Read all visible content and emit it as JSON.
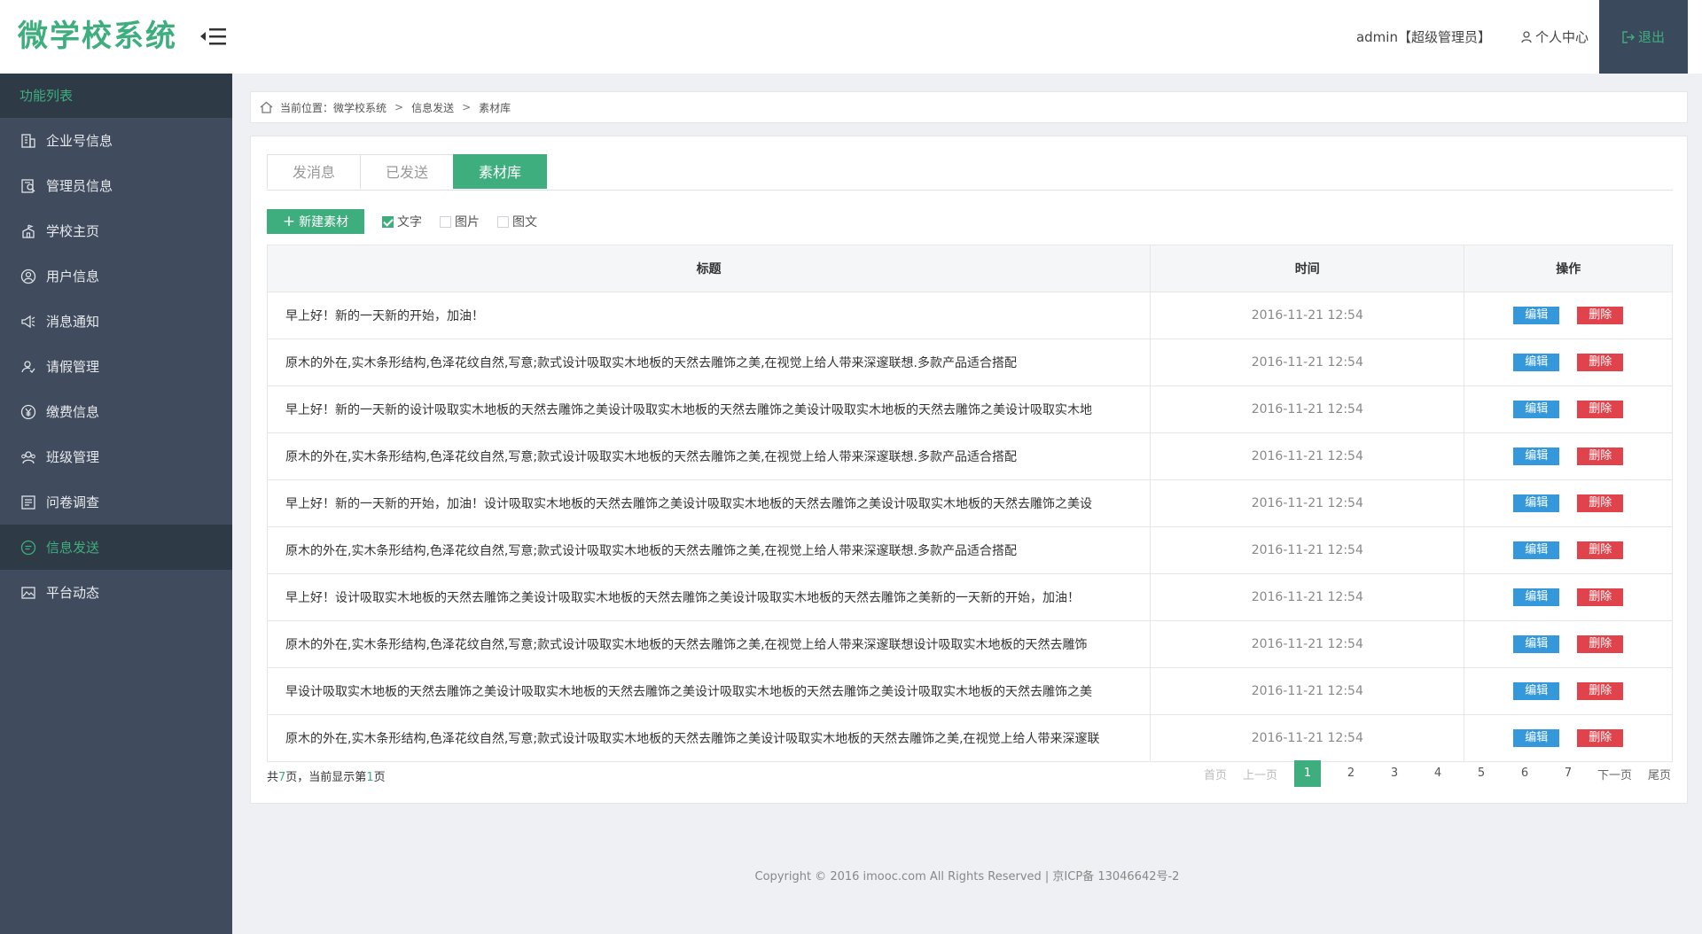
{
  "header": {
    "logo": "微学校系统",
    "user_label": "admin【超级管理员】",
    "personal_center": "个人中心",
    "logout": "退出"
  },
  "sidebar": {
    "title": "功能列表",
    "items": [
      {
        "label": "企业号信息",
        "icon": "building-icon"
      },
      {
        "label": "管理员信息",
        "icon": "admin-card-icon"
      },
      {
        "label": "学校主页",
        "icon": "school-icon"
      },
      {
        "label": "用户信息",
        "icon": "user-icon"
      },
      {
        "label": "消息通知",
        "icon": "megaphone-icon"
      },
      {
        "label": "请假管理",
        "icon": "leave-icon"
      },
      {
        "label": "缴费信息",
        "icon": "yuan-icon"
      },
      {
        "label": "班级管理",
        "icon": "class-icon"
      },
      {
        "label": "问卷调查",
        "icon": "survey-icon"
      },
      {
        "label": "信息发送",
        "icon": "message-icon",
        "active": true
      },
      {
        "label": "平台动态",
        "icon": "image-icon"
      }
    ]
  },
  "breadcrumb": {
    "prefix": "当前位置：微学校系统",
    "level2": "信息发送",
    "level3": "素材库",
    "separator": ">"
  },
  "tabs": [
    {
      "label": "发消息",
      "active": false
    },
    {
      "label": "已发送",
      "active": false
    },
    {
      "label": "素材库",
      "active": true
    }
  ],
  "toolbar": {
    "new_button": "新建素材",
    "filters": [
      {
        "label": "文字",
        "checked": true
      },
      {
        "label": "图片",
        "checked": false
      },
      {
        "label": "图文",
        "checked": false
      }
    ]
  },
  "table": {
    "headers": [
      "标题",
      "时间",
      "操作"
    ],
    "edit_label": "编辑",
    "delete_label": "删除",
    "rows": [
      {
        "title": "早上好！新的一天新的开始，加油！",
        "time": "2016-11-21  12:54"
      },
      {
        "title": "原木的外在,实木条形结构,色泽花纹自然,写意;款式设计吸取实木地板的天然去雕饰之美,在视觉上给人带来深邃联想.多款产品适合搭配",
        "time": "2016-11-21  12:54"
      },
      {
        "title": "早上好！新的一天新的设计吸取实木地板的天然去雕饰之美设计吸取实木地板的天然去雕饰之美设计吸取实木地板的天然去雕饰之美设计吸取实木地",
        "time": "2016-11-21  12:54"
      },
      {
        "title": "原木的外在,实木条形结构,色泽花纹自然,写意;款式设计吸取实木地板的天然去雕饰之美,在视觉上给人带来深邃联想.多款产品适合搭配",
        "time": "2016-11-21  12:54"
      },
      {
        "title": "早上好！新的一天新的开始，加油！设计吸取实木地板的天然去雕饰之美设计吸取实木地板的天然去雕饰之美设计吸取实木地板的天然去雕饰之美设",
        "time": "2016-11-21  12:54"
      },
      {
        "title": "原木的外在,实木条形结构,色泽花纹自然,写意;款式设计吸取实木地板的天然去雕饰之美,在视觉上给人带来深邃联想.多款产品适合搭配",
        "time": "2016-11-21  12:54"
      },
      {
        "title": "早上好！设计吸取实木地板的天然去雕饰之美设计吸取实木地板的天然去雕饰之美设计吸取实木地板的天然去雕饰之美新的一天新的开始，加油！",
        "time": "2016-11-21  12:54"
      },
      {
        "title": "原木的外在,实木条形结构,色泽花纹自然,写意;款式设计吸取实木地板的天然去雕饰之美,在视觉上给人带来深邃联想设计吸取实木地板的天然去雕饰",
        "time": "2016-11-21  12:54"
      },
      {
        "title": "早设计吸取实木地板的天然去雕饰之美设计吸取实木地板的天然去雕饰之美设计吸取实木地板的天然去雕饰之美设计吸取实木地板的天然去雕饰之美",
        "time": "2016-11-21  12:54"
      },
      {
        "title": "原木的外在,实木条形结构,色泽花纹自然,写意;款式设计吸取实木地板的天然去雕饰之美设计吸取实木地板的天然去雕饰之美,在视觉上给人带来深邃联",
        "time": "2016-11-21  12:54"
      }
    ]
  },
  "pagination": {
    "info_prefix": "共",
    "total_pages": "7",
    "info_middle": "页，当前显示第",
    "current_page": "1",
    "info_suffix": "页",
    "first": "首页",
    "prev": "上一页",
    "pages": [
      "1",
      "2",
      "3",
      "4",
      "5",
      "6",
      "7"
    ],
    "next": "下一页",
    "last": "尾页"
  },
  "footer": "Copyright © 2016 imooc.com All Rights Reserved | 京ICP备 13046642号-2",
  "colors": {
    "accent": "#3fae7e",
    "sidebar": "#404c5e",
    "sidebar_dark": "#2f3a47",
    "edit": "#3498db",
    "delete": "#e0434b"
  }
}
